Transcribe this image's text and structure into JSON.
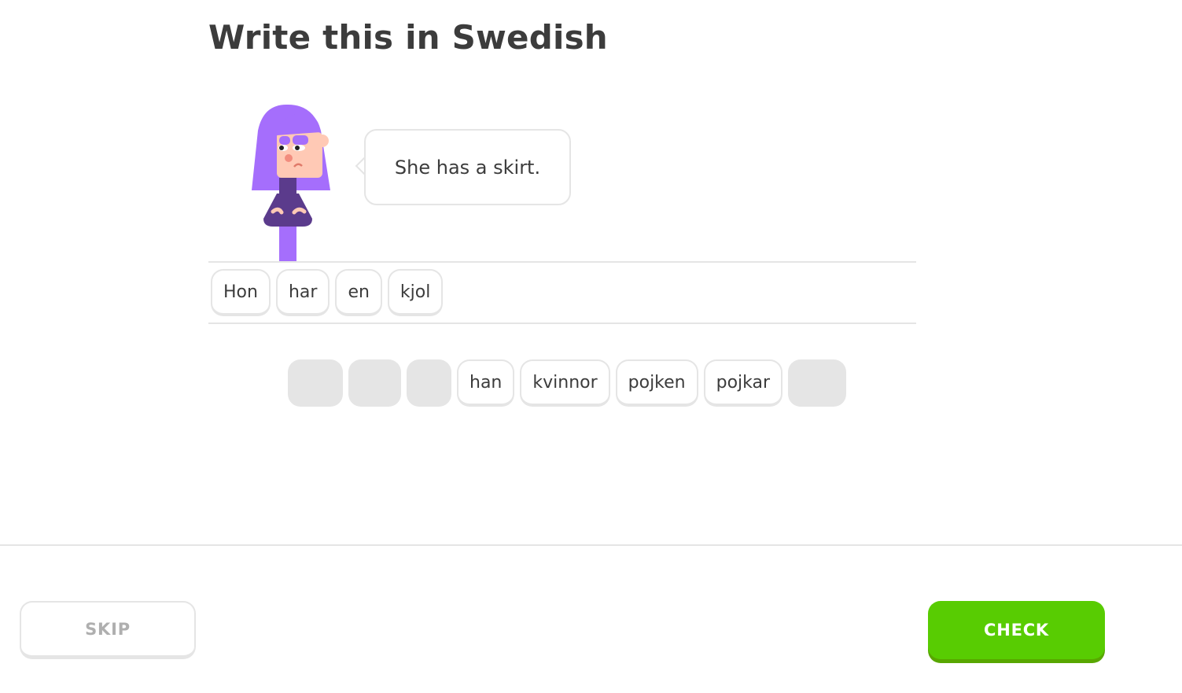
{
  "header": {
    "title": "Write this in Swedish"
  },
  "prompt": {
    "sentence": "She has a skirt."
  },
  "answer": {
    "words": [
      "Hon",
      "har",
      "en",
      "kjol"
    ]
  },
  "bank": {
    "items": [
      {
        "used": true,
        "label": ""
      },
      {
        "used": true,
        "label": ""
      },
      {
        "used": true,
        "label": ""
      },
      {
        "used": false,
        "label": "han"
      },
      {
        "used": false,
        "label": "kvinnor"
      },
      {
        "used": false,
        "label": "pojken"
      },
      {
        "used": false,
        "label": "pojkar"
      },
      {
        "used": true,
        "label": ""
      }
    ]
  },
  "footer": {
    "skip_label": "SKIP",
    "check_label": "CHECK"
  },
  "colors": {
    "accent_green": "#58cc02",
    "accent_green_shadow": "#58a700",
    "border_gray": "#e5e5e5",
    "text_dark": "#3c3c3c",
    "skip_text": "#afafaf",
    "character_hair": "#a56efc",
    "character_shirt": "#5b3b8c"
  }
}
